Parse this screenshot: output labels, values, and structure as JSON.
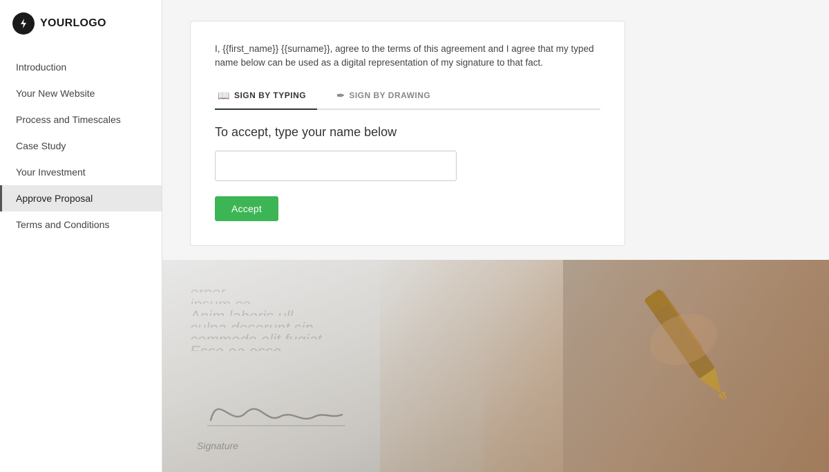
{
  "logo": {
    "icon": "⚡",
    "text_your": "YOUR",
    "text_logo": "LOGO"
  },
  "sidebar": {
    "items": [
      {
        "id": "introduction",
        "label": "Introduction",
        "active": false
      },
      {
        "id": "your-new-website",
        "label": "Your New Website",
        "active": false
      },
      {
        "id": "process-and-timescales",
        "label": "Process and Timescales",
        "active": false
      },
      {
        "id": "case-study",
        "label": "Case Study",
        "active": false
      },
      {
        "id": "your-investment",
        "label": "Your Investment",
        "active": false
      },
      {
        "id": "approve-proposal",
        "label": "Approve Proposal",
        "active": true
      },
      {
        "id": "terms-and-conditions",
        "label": "Terms and Conditions",
        "active": false
      }
    ]
  },
  "card": {
    "agreement_text": "I, {{first_name}} {{surname}}, agree to the terms of this agreement and I agree that my typed name below can be used as a digital representation of my signature to that fact.",
    "tab_typing_label": "SIGN BY TYPING",
    "tab_drawing_label": "SIGN BY DRAWING",
    "sign_instruction": "To accept, type your name below",
    "name_input_placeholder": "",
    "accept_button_label": "Accept"
  },
  "bottom_image": {
    "doc_lines": [
      "orpor...",
      "ipsum co...",
      "Anim laboris ull...",
      "culpa deserunt sin...",
      "commodo elit fugiat ...",
      "Esse ea esse."
    ],
    "signature_label": "Signature"
  }
}
